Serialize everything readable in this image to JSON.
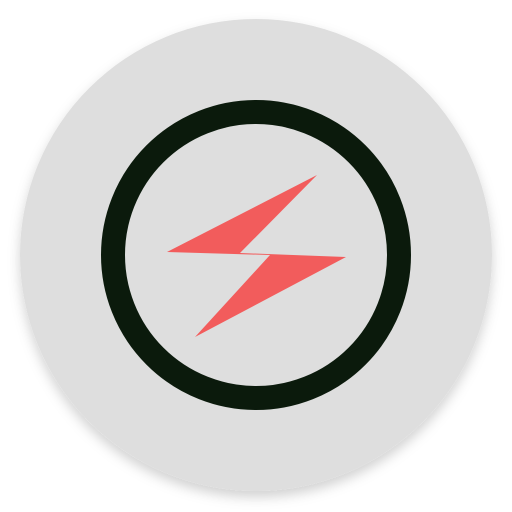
{
  "icon": {
    "name": "lightning-bolt-icon",
    "colors": {
      "badge_background": "#DEDEDE",
      "ring": "#0B1A0C",
      "bolt": "#F25C5C"
    }
  }
}
